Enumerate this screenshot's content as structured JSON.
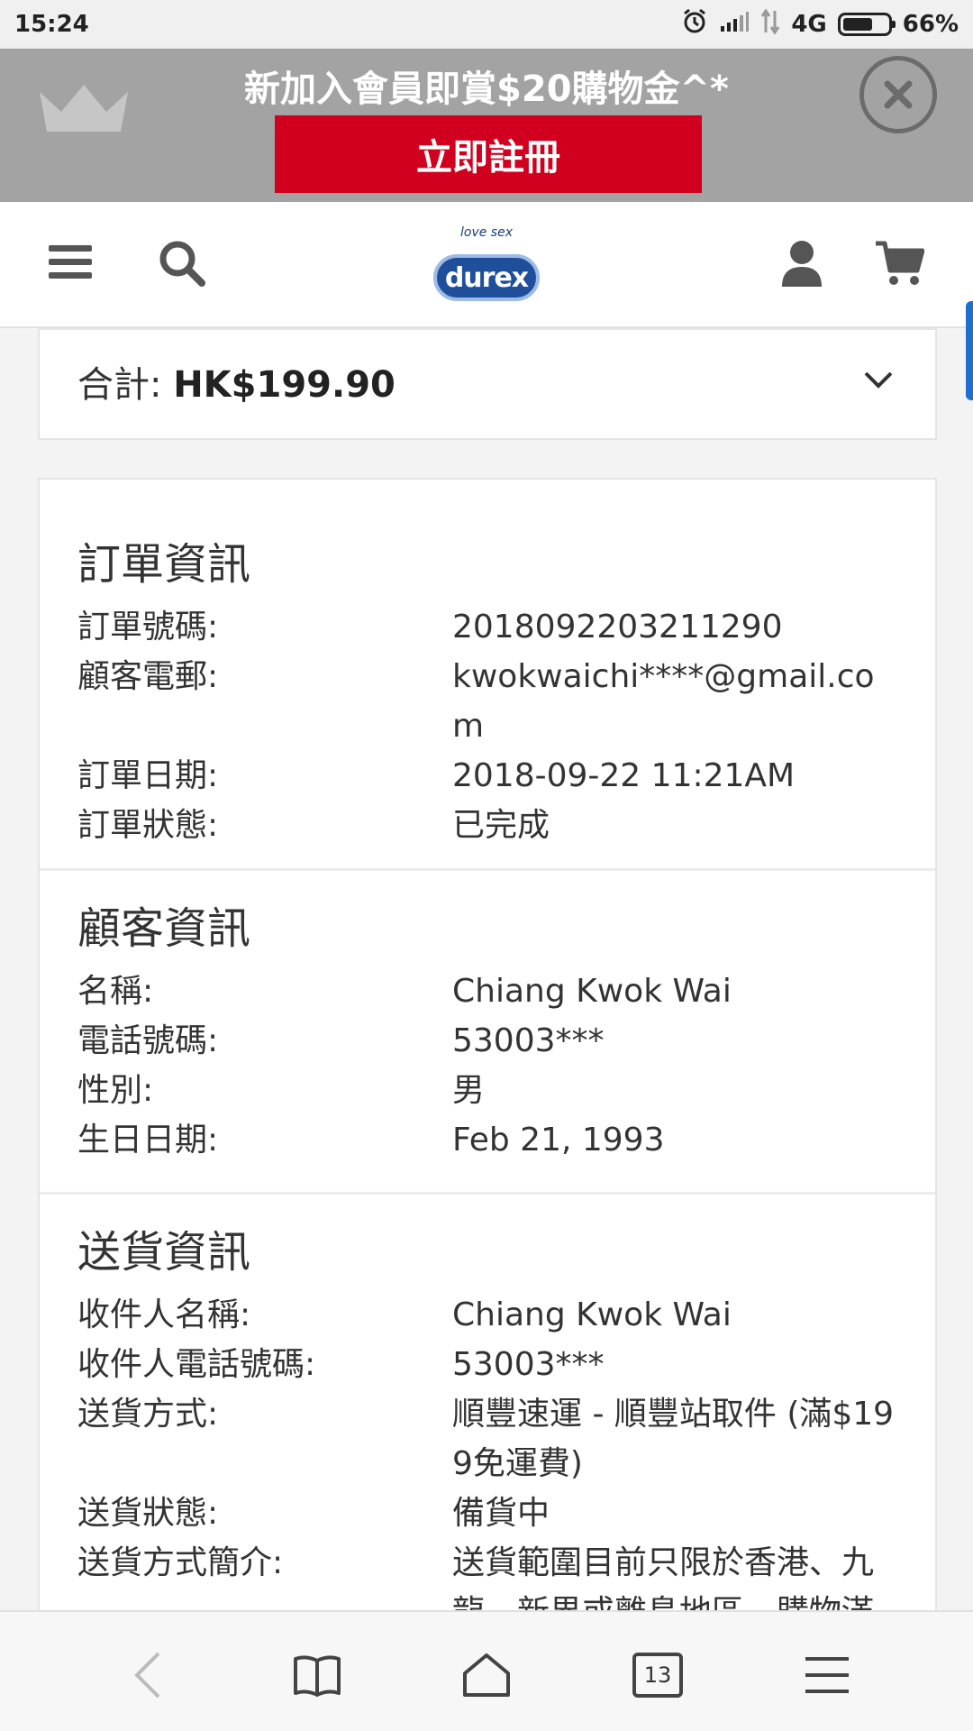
{
  "status_bar": {
    "time": "15:24",
    "network": "4G",
    "battery": "66%",
    "battery_level": 0.66,
    "icons": [
      "alarm-icon",
      "signal-icon",
      "data-arrows-icon",
      "battery-icon"
    ]
  },
  "promo": {
    "text": "新加入會員即賞$20購物金^*",
    "button_label": "立即註冊",
    "button_color": "#d1001f",
    "close_icon": "close-icon",
    "crown_icon": "crown-icon"
  },
  "header": {
    "logo_tagline": "love sex",
    "logo_text": "durex",
    "icons": [
      "menu-icon",
      "search-icon",
      "user-icon",
      "cart-icon"
    ]
  },
  "total": {
    "label": "合計:",
    "amount": "HK$199.90"
  },
  "order_info": {
    "title": "訂單資訊",
    "rows": [
      {
        "label": "訂單號碼:",
        "value": "2018092203211290"
      },
      {
        "label": "顧客電郵:",
        "value": "kwokwaichi****@gmail.com"
      },
      {
        "label": "訂單日期:",
        "value": "2018-09-22 11:21AM"
      },
      {
        "label": "訂單狀態:",
        "value": "已完成"
      }
    ]
  },
  "customer_info": {
    "title": "顧客資訊",
    "rows": [
      {
        "label": "名稱:",
        "value": "Chiang Kwok Wai"
      },
      {
        "label": "電話號碼:",
        "value": "53003***"
      },
      {
        "label": "性別:",
        "value": "男"
      },
      {
        "label": "生日日期:",
        "value": "Feb 21, 1993"
      }
    ]
  },
  "delivery_info": {
    "title": "送貨資訊",
    "rows": [
      {
        "label": "收件人名稱:",
        "value": "Chiang Kwok Wai"
      },
      {
        "label": "收件人電話號碼:",
        "value": "53003***"
      },
      {
        "label": "送貨方式:",
        "value": "順豐速運 - 順豐站取件 (滿$199免運費)"
      },
      {
        "label": "送貨狀態:",
        "value": "備貨中"
      },
      {
        "label": "送貨方式簡介:",
        "value": "送貨範圍目前只限於香港、九龍、新界或離島地區，購物滿"
      }
    ]
  },
  "bottom_bar": {
    "tab_count": "13",
    "icons": [
      "back-icon",
      "bookmarks-icon",
      "home-icon",
      "tabs-icon",
      "menu-icon"
    ]
  }
}
